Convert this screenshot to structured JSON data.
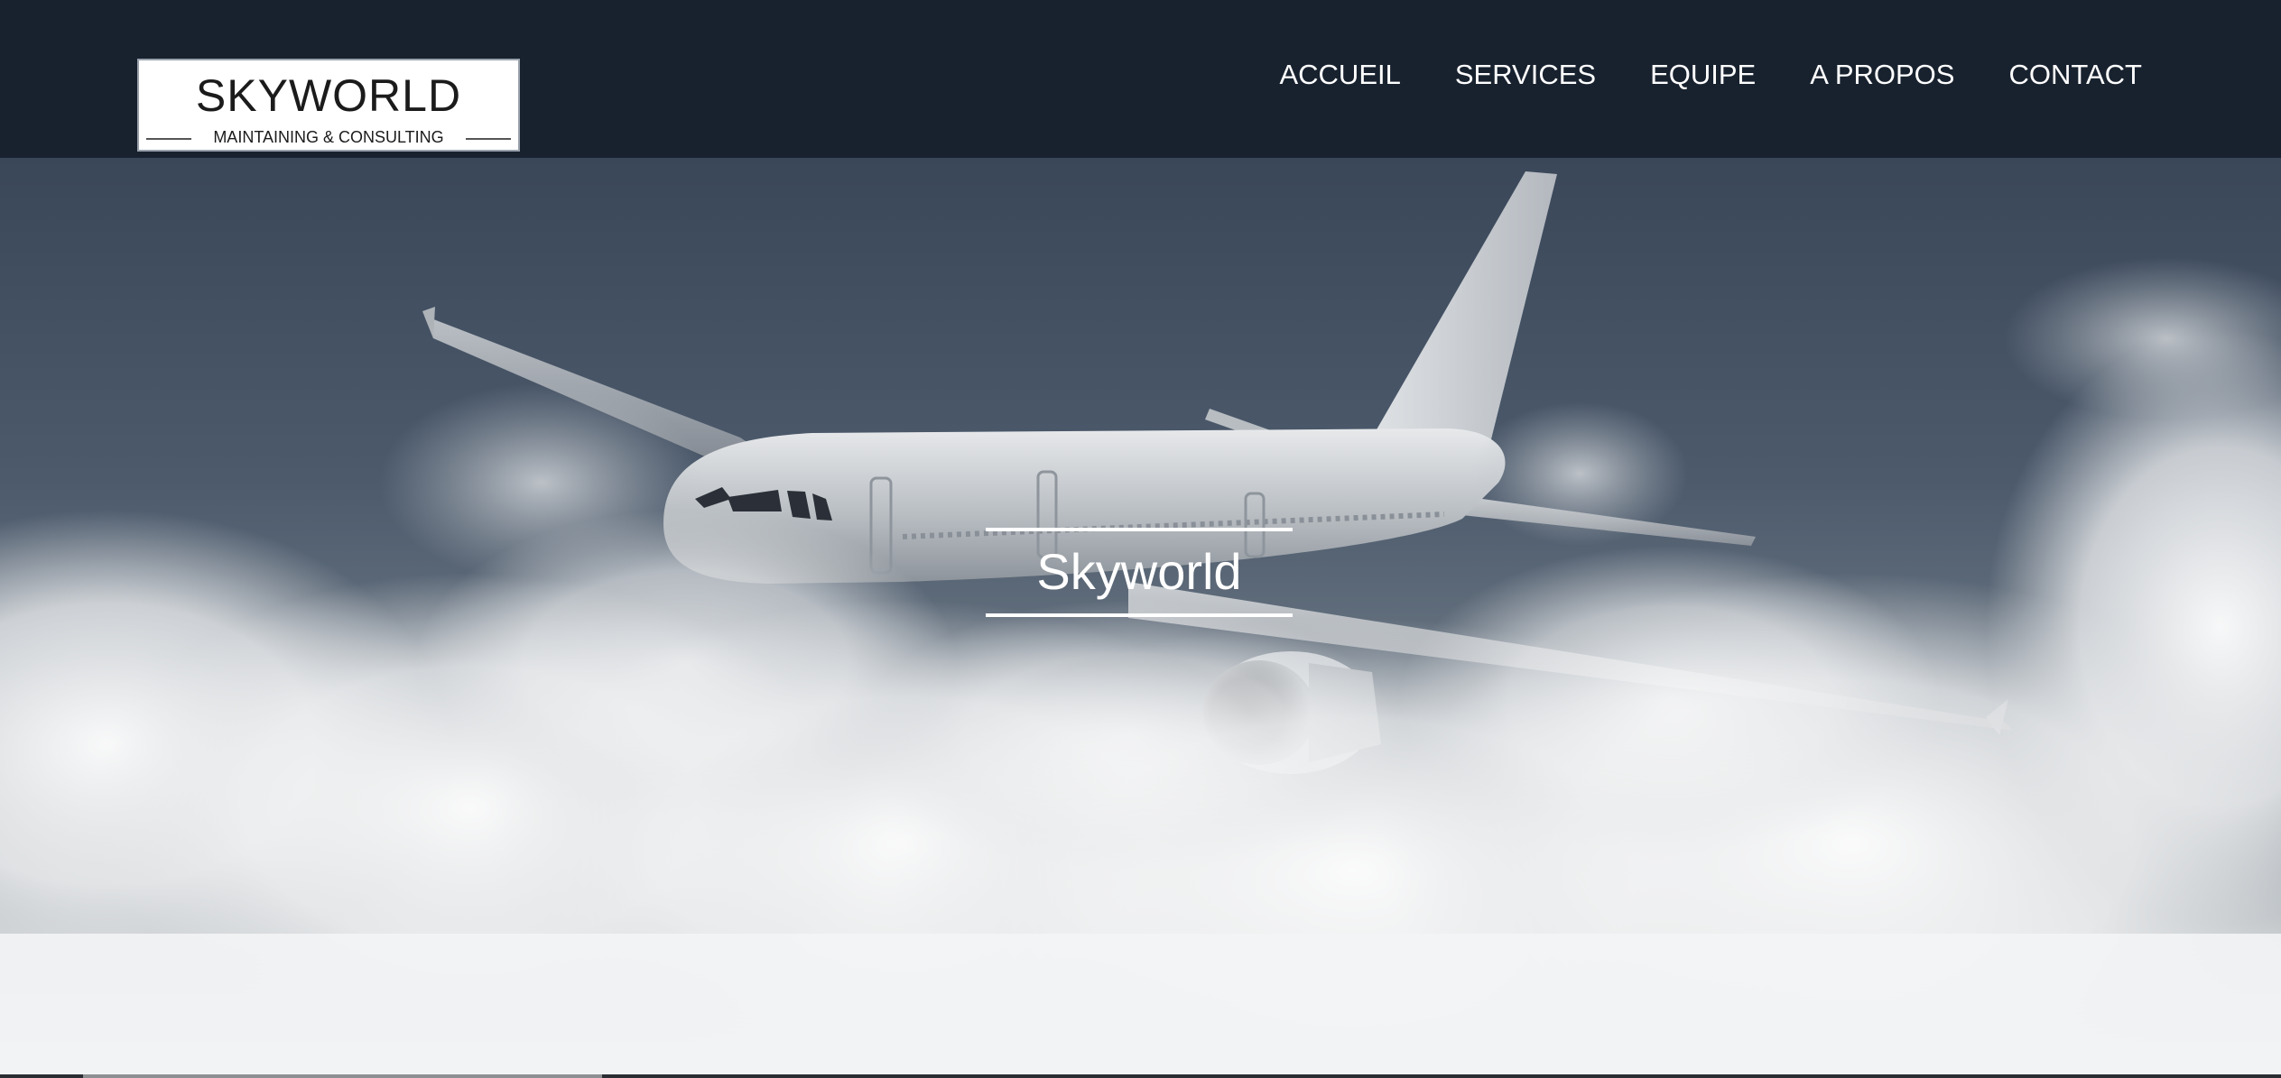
{
  "logo": {
    "title": "SKYWORLD",
    "subtitle": "MAINTAINING & CONSULTING"
  },
  "nav": {
    "items": [
      {
        "label": "ACCUEIL"
      },
      {
        "label": "SERVICES"
      },
      {
        "label": "EQUIPE"
      },
      {
        "label": "A PROPOS"
      },
      {
        "label": "CONTACT"
      }
    ]
  },
  "hero": {
    "title": "Skyworld",
    "image_subject": "airplane-above-clouds"
  },
  "colors": {
    "header_bg": "#18222f",
    "nav_text": "#ffffff",
    "hero_title": "#ffffff"
  }
}
